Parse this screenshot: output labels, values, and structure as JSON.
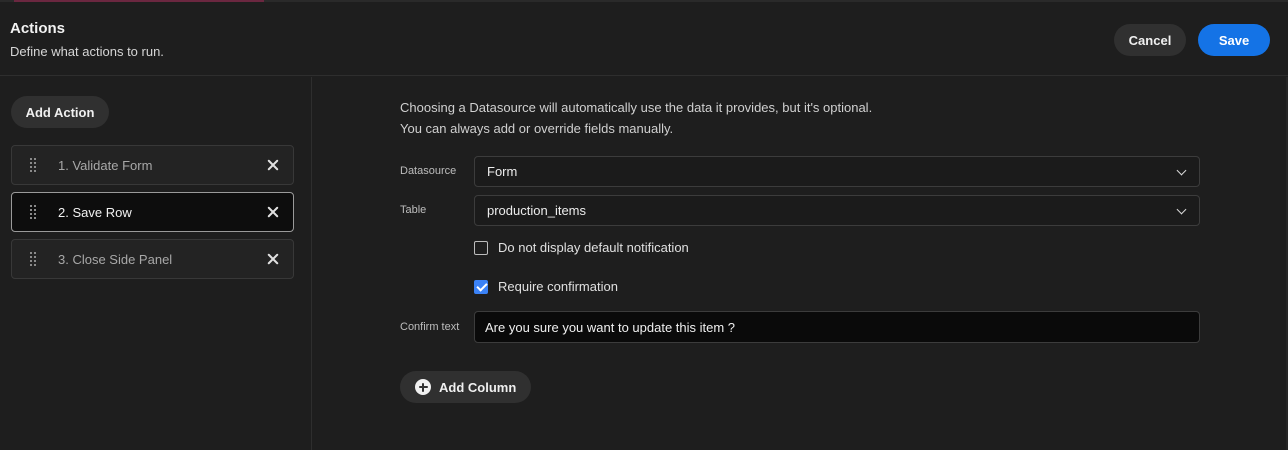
{
  "header": {
    "title": "Actions",
    "subtitle": "Define what actions to run.",
    "cancel_label": "Cancel",
    "save_label": "Save"
  },
  "sidebar": {
    "add_action_label": "Add Action",
    "actions": [
      {
        "label": "1. Validate Form",
        "selected": false
      },
      {
        "label": "2. Save Row",
        "selected": true
      },
      {
        "label": "3. Close Side Panel",
        "selected": false
      }
    ]
  },
  "main": {
    "info_line1": "Choosing a Datasource will automatically use the data it provides, but it's optional.",
    "info_line2": "You can always add or override fields manually.",
    "datasource": {
      "label": "Datasource",
      "value": "Form"
    },
    "table": {
      "label": "Table",
      "value": "production_items"
    },
    "no_notification": {
      "label": "Do not display default notification",
      "checked": false
    },
    "require_confirmation": {
      "label": "Require confirmation",
      "checked": true
    },
    "confirm_text": {
      "label": "Confirm text",
      "value": "Are you sure you want to update this item ?"
    },
    "add_column_label": "Add Column"
  },
  "colors": {
    "accent": "#1473e6",
    "checkbox": "#3b82f6",
    "background": "#1e1e1e"
  }
}
